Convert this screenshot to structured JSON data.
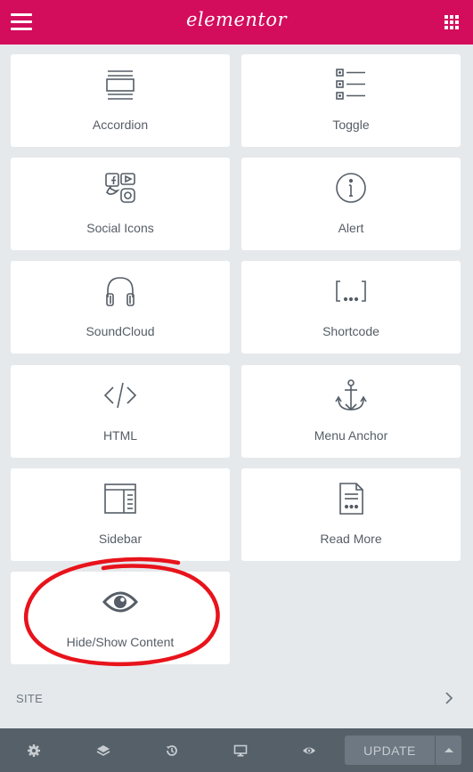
{
  "header": {
    "logo": "elementor",
    "menu_icon": "hamburger-icon",
    "widgets_icon": "grid-icon"
  },
  "widgets": [
    {
      "label": "Accordion",
      "icon": "accordion-icon"
    },
    {
      "label": "Toggle",
      "icon": "toggle-icon"
    },
    {
      "label": "Social Icons",
      "icon": "social-icons-icon"
    },
    {
      "label": "Alert",
      "icon": "alert-icon"
    },
    {
      "label": "SoundCloud",
      "icon": "headphones-icon"
    },
    {
      "label": "Shortcode",
      "icon": "shortcode-icon"
    },
    {
      "label": "HTML",
      "icon": "code-icon"
    },
    {
      "label": "Menu Anchor",
      "icon": "anchor-icon"
    },
    {
      "label": "Sidebar",
      "icon": "sidebar-icon"
    },
    {
      "label": "Read More",
      "icon": "document-icon"
    },
    {
      "label": "Hide/Show Content",
      "icon": "eye-icon"
    }
  ],
  "site_section": {
    "label": "SITE",
    "icon": "chevron-right-icon"
  },
  "footer": {
    "icons": [
      "settings-icon",
      "layers-icon",
      "history-icon",
      "desktop-icon",
      "preview-icon"
    ],
    "update_label": "UPDATE",
    "update_menu_icon": "caret-up-icon"
  },
  "colors": {
    "brand": "#d30c5c",
    "panel_bg": "#e6e9ec",
    "footer_bg": "#556068",
    "annotation": "#e8131b"
  }
}
